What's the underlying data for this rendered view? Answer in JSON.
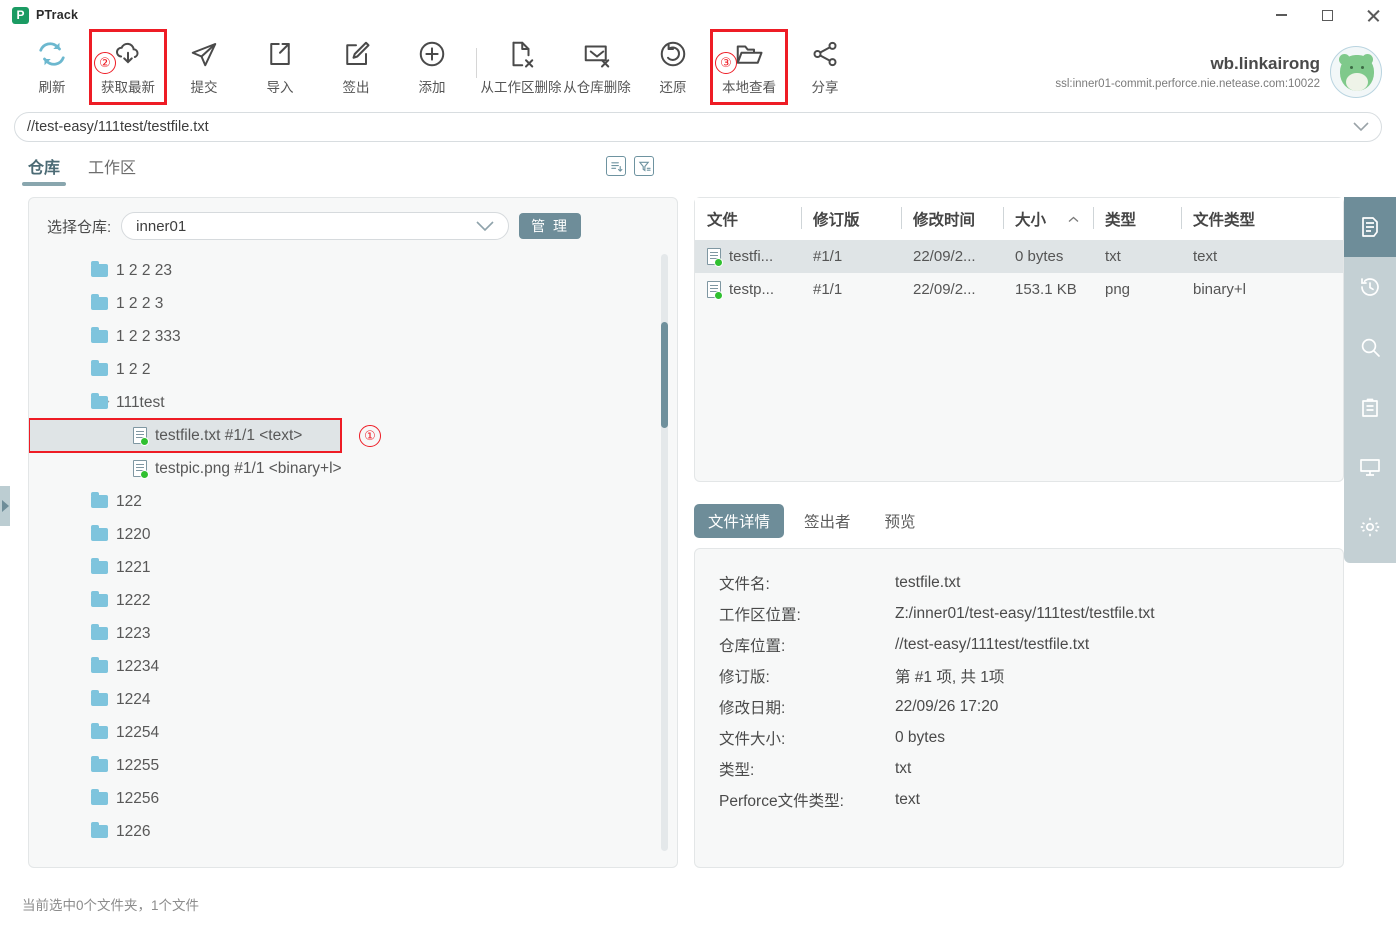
{
  "window": {
    "app_name": "PTrack",
    "logo_letter": "P",
    "minimize": "minimize-button",
    "maximize": "maximize-button",
    "close": "close-button"
  },
  "toolbar": {
    "items": [
      {
        "label": "刷新",
        "icon": "refresh-icon",
        "badge": null,
        "highlight": false
      },
      {
        "label": "获取最新",
        "icon": "cloud-download-icon",
        "badge": "②",
        "highlight": true
      },
      {
        "label": "提交",
        "icon": "send-icon",
        "badge": null,
        "highlight": false
      },
      {
        "label": "导入",
        "icon": "import-icon",
        "badge": null,
        "highlight": false
      },
      {
        "label": "签出",
        "icon": "edit-icon",
        "badge": null,
        "highlight": false
      },
      {
        "label": "添加",
        "icon": "plus-circle-icon",
        "badge": null,
        "highlight": false
      },
      {
        "label": "从工作区删除",
        "icon": "file-delete-icon",
        "badge": null,
        "highlight": false
      },
      {
        "label": "从仓库删除",
        "icon": "archive-delete-icon",
        "badge": null,
        "highlight": false
      },
      {
        "label": "还原",
        "icon": "undo-icon",
        "badge": null,
        "highlight": false
      },
      {
        "label": "本地查看",
        "icon": "folder-open-icon",
        "badge": "③",
        "highlight": true
      },
      {
        "label": "分享",
        "icon": "share-icon",
        "badge": null,
        "highlight": false
      }
    ]
  },
  "user": {
    "name": "wb.linkairong",
    "server": "ssl:inner01-commit.perforce.nie.netease.com:10022",
    "avatar": "user-avatar"
  },
  "path_bar": {
    "value": "//test-easy/111test/testfile.txt",
    "dropdown_icon": "chevron-down-icon"
  },
  "tabs": {
    "items": [
      {
        "label": "仓库",
        "active": true
      },
      {
        "label": "工作区",
        "active": false
      }
    ],
    "icons": [
      {
        "name": "list-detail-icon"
      },
      {
        "name": "filter-icon"
      }
    ]
  },
  "repo": {
    "label": "选择仓库:",
    "selected": "inner01",
    "caret": "chevron-down-icon",
    "manage_label": "管 理"
  },
  "tree": {
    "rows": [
      {
        "label": "1 2 2 23",
        "type": "folder",
        "expanded": false,
        "indent": 0,
        "selected": false,
        "boxed": false,
        "badge": null
      },
      {
        "label": "1 2 2 3",
        "type": "folder",
        "expanded": false,
        "indent": 0,
        "selected": false,
        "boxed": false,
        "badge": null
      },
      {
        "label": "1 2 2 333",
        "type": "folder",
        "expanded": false,
        "indent": 0,
        "selected": false,
        "boxed": false,
        "badge": null
      },
      {
        "label": "1 2 2",
        "type": "folder",
        "expanded": false,
        "indent": 0,
        "selected": false,
        "boxed": false,
        "badge": null
      },
      {
        "label": "111test",
        "type": "folder",
        "expanded": true,
        "indent": 0,
        "selected": false,
        "boxed": false,
        "badge": null
      },
      {
        "label": "testfile.txt  #1/1 <text>",
        "type": "file",
        "expanded": false,
        "indent": 1,
        "selected": true,
        "boxed": true,
        "badge": "①"
      },
      {
        "label": "testpic.png  #1/1 <binary+l>",
        "type": "file",
        "expanded": false,
        "indent": 1,
        "selected": false,
        "boxed": false,
        "badge": null
      },
      {
        "label": "122",
        "type": "folder",
        "expanded": false,
        "indent": 0,
        "selected": false,
        "boxed": false,
        "badge": null
      },
      {
        "label": "1220",
        "type": "folder",
        "expanded": false,
        "indent": 0,
        "selected": false,
        "boxed": false,
        "badge": null
      },
      {
        "label": "1221",
        "type": "folder",
        "expanded": false,
        "indent": 0,
        "selected": false,
        "boxed": false,
        "badge": null
      },
      {
        "label": "1222",
        "type": "folder",
        "expanded": false,
        "indent": 0,
        "selected": false,
        "boxed": false,
        "badge": null
      },
      {
        "label": "1223",
        "type": "folder",
        "expanded": false,
        "indent": 0,
        "selected": false,
        "boxed": false,
        "badge": null
      },
      {
        "label": "12234",
        "type": "folder",
        "expanded": false,
        "indent": 0,
        "selected": false,
        "boxed": false,
        "badge": null
      },
      {
        "label": "1224",
        "type": "folder",
        "expanded": false,
        "indent": 0,
        "selected": false,
        "boxed": false,
        "badge": null
      },
      {
        "label": "12254",
        "type": "folder",
        "expanded": false,
        "indent": 0,
        "selected": false,
        "boxed": false,
        "badge": null
      },
      {
        "label": "12255",
        "type": "folder",
        "expanded": false,
        "indent": 0,
        "selected": false,
        "boxed": false,
        "badge": null
      },
      {
        "label": "12256",
        "type": "folder",
        "expanded": false,
        "indent": 0,
        "selected": false,
        "boxed": false,
        "badge": null
      },
      {
        "label": "1226",
        "type": "folder",
        "expanded": false,
        "indent": 0,
        "selected": false,
        "boxed": false,
        "badge": null
      }
    ]
  },
  "file_table": {
    "columns": [
      "文件",
      "修订版",
      "修改时间",
      "大小",
      "类型",
      "文件类型"
    ],
    "sort_column": "大小",
    "sort_icon": "chevron-up-icon",
    "rows": [
      {
        "file": "testfi...",
        "rev": "#1/1",
        "time": "22/09/2...",
        "size": "0 bytes",
        "type": "txt",
        "ftype": "text",
        "selected": true
      },
      {
        "file": "testp...",
        "rev": "#1/1",
        "time": "22/09/2...",
        "size": "153.1 KB",
        "type": "png",
        "ftype": "binary+l",
        "selected": false
      }
    ]
  },
  "detail": {
    "tabs": [
      {
        "label": "文件详情",
        "active": true
      },
      {
        "label": "签出者",
        "active": false
      },
      {
        "label": "预览",
        "active": false
      }
    ],
    "rows": [
      {
        "key": "文件名:",
        "value": "testfile.txt"
      },
      {
        "key": "工作区位置:",
        "value": "Z:/inner01/test-easy/111test/testfile.txt"
      },
      {
        "key": "仓库位置:",
        "value": "//test-easy/111test/testfile.txt"
      },
      {
        "key": "修订版:",
        "value": "第 #1 项, 共 1项"
      },
      {
        "key": "修改日期:",
        "value": "22/09/26 17:20"
      },
      {
        "key": "文件大小:",
        "value": "0 bytes"
      },
      {
        "key": "类型:",
        "value": "txt"
      },
      {
        "key": "Perforce文件类型:",
        "value": "text"
      }
    ]
  },
  "rail": {
    "items": [
      {
        "icon": "document-icon",
        "active": true
      },
      {
        "icon": "history-icon",
        "active": false
      },
      {
        "icon": "search-icon",
        "active": false
      },
      {
        "icon": "clipboard-icon",
        "active": false
      },
      {
        "icon": "monitor-icon",
        "active": false
      },
      {
        "icon": "gear-icon",
        "active": false
      }
    ]
  },
  "status_bar": {
    "text": "当前选中0个文件夹，1个文件"
  },
  "colors": {
    "accent": "#6e8d99",
    "rail_bg": "#c4d0d4",
    "highlight_box": "#ee1c25",
    "folder": "#7ec4dd",
    "logo_green": "#1b9b63"
  }
}
